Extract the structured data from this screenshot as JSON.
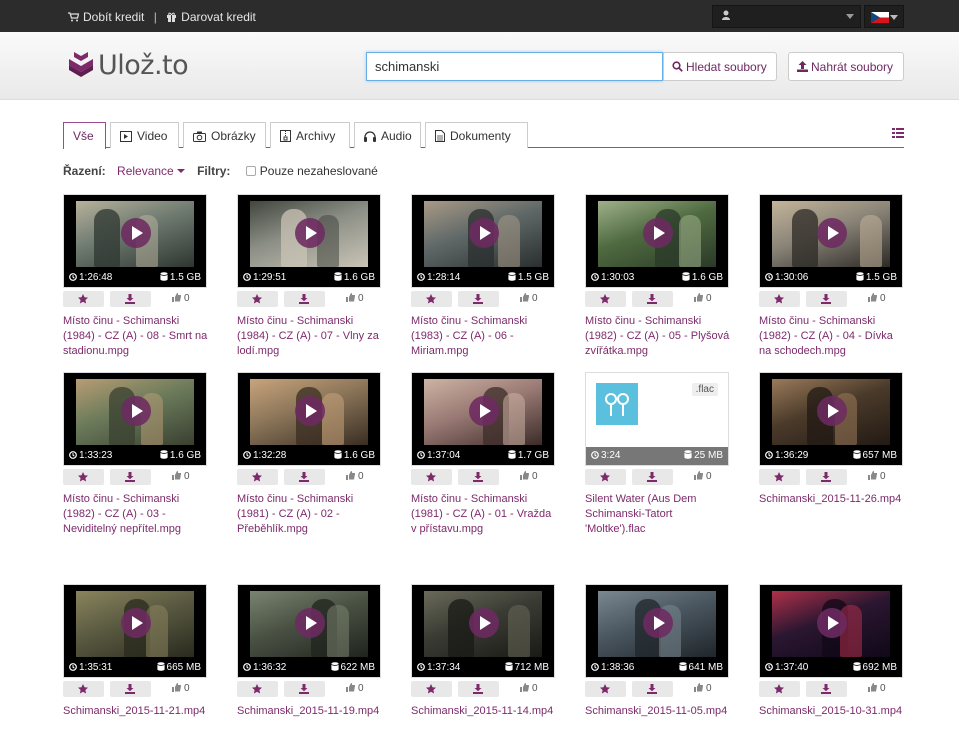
{
  "topbar": {
    "credit_link": "Dobít kredit",
    "gift_link": "Darovat kredit",
    "user_name": ""
  },
  "brand": {
    "name": "Ulož.to",
    "accent": "#7d2a6b"
  },
  "search": {
    "value": "schimanski",
    "button_label": "Hledat soubory"
  },
  "upload": {
    "button_label": "Nahrát soubory"
  },
  "tabs": [
    {
      "label": "Vše",
      "icon": "none",
      "active": true
    },
    {
      "label": "Video",
      "icon": "video-icon"
    },
    {
      "label": "Obrázky",
      "icon": "camera-icon"
    },
    {
      "label": "Archivy",
      "icon": "archive-icon"
    },
    {
      "label": "Audio",
      "icon": "headphones-icon"
    },
    {
      "label": "Dokumenty",
      "icon": "document-icon"
    }
  ],
  "filters": {
    "sort_label": "Řazení:",
    "sort_value": "Relevance",
    "filter_label": "Filtry:",
    "checkbox_label": "Pouze nezaheslované"
  },
  "files": [
    {
      "name": "Místo činu - Schimanski (1984) - CZ (A) - 08 - Smrt na stadionu.mpg",
      "duration": "1:26:48",
      "size": "1.5 GB",
      "likes": "0",
      "type": "video",
      "palette": [
        "#6e7a70",
        "#b7b29c",
        "#2e3530"
      ]
    },
    {
      "name": "Místo činu - Schimanski (1984) - CZ (A) - 07 - Vlny za lodí.mpg",
      "duration": "1:29:51",
      "size": "1.6 GB",
      "likes": "0",
      "type": "video",
      "palette": [
        "#8c8f86",
        "#42463e",
        "#c9c4b6"
      ]
    },
    {
      "name": "Místo činu - Schimanski (1983) - CZ (A) - 06 - Miriam.mpg",
      "duration": "1:28:14",
      "size": "1.5 GB",
      "likes": "0",
      "type": "video",
      "palette": [
        "#5f6868",
        "#a89a86",
        "#2a2e2e"
      ]
    },
    {
      "name": "Místo činu - Schimanski (1982) - CZ (A) - 05 - Plyšová zvířátka.mpg",
      "duration": "1:30:03",
      "size": "1.6 GB",
      "likes": "0",
      "type": "video",
      "palette": [
        "#4f6a40",
        "#9fb08a",
        "#2a3a28"
      ]
    },
    {
      "name": "Místo činu - Schimanski (1982) - CZ (A) - 04 - Dívka na schodech.mpg",
      "duration": "1:30:06",
      "size": "1.5 GB",
      "likes": "0",
      "type": "video",
      "palette": [
        "#8a8478",
        "#c4b59a",
        "#2c2a26"
      ]
    },
    {
      "name": "Místo činu - Schimanski (1982) - CZ (A) - 03 - Neviditelný nepřítel.mpg",
      "duration": "1:33:23",
      "size": "1.6 GB",
      "likes": "0",
      "type": "video",
      "palette": [
        "#6a7a5a",
        "#b79d74",
        "#3a4030"
      ]
    },
    {
      "name": "Místo činu - Schimanski (1981) - CZ (A) - 02 - Přeběhlík.mpg",
      "duration": "1:32:28",
      "size": "1.6 GB",
      "likes": "0",
      "type": "video",
      "palette": [
        "#8a7458",
        "#c8a47c",
        "#3a2e22"
      ]
    },
    {
      "name": "Místo činu - Schimanski (1981) - CZ (A) - 01 - Vražda v přístavu.mpg",
      "duration": "1:37:04",
      "size": "1.7 GB",
      "likes": "0",
      "type": "video",
      "palette": [
        "#9a7a74",
        "#cdb3a4",
        "#3c2c2a"
      ]
    },
    {
      "name": "Silent Water (Aus Dem Schimanski-Tatort 'Moltke').flac",
      "duration": "3:24",
      "size": "25 MB",
      "likes": "0",
      "type": "audio",
      "ext": ".flac",
      "palette": [
        "#5bc0de",
        "#ffffff",
        "#777777"
      ]
    },
    {
      "name": "Schimanski_2015-11-26.mp4",
      "duration": "1:36:29",
      "size": "657 MB",
      "likes": "0",
      "type": "video",
      "palette": [
        "#4a3a2a",
        "#9a7a5a",
        "#221a14"
      ]
    },
    {
      "name": "Schimanski_2015-11-21.mp4",
      "duration": "1:35:31",
      "size": "665 MB",
      "likes": "0",
      "type": "video",
      "palette": [
        "#5a5a42",
        "#8a845c",
        "#2a2a1e"
      ]
    },
    {
      "name": "Schimanski_2015-11-19.mp4",
      "duration": "1:36:32",
      "size": "622 MB",
      "likes": "0",
      "type": "video",
      "palette": [
        "#4a5244",
        "#7a8470",
        "#20241e"
      ]
    },
    {
      "name": "Schimanski_2015-11-14.mp4",
      "duration": "1:37:34",
      "size": "712 MB",
      "likes": "0",
      "type": "video",
      "palette": [
        "#3a3c34",
        "#6a6a5a",
        "#1a1a16"
      ]
    },
    {
      "name": "Schimanski_2015-11-05.mp4",
      "duration": "1:38:36",
      "size": "641 MB",
      "likes": "0",
      "type": "video",
      "palette": [
        "#4a5660",
        "#7a8890",
        "#20262a"
      ]
    },
    {
      "name": "Schimanski_2015-10-31.mp4",
      "duration": "1:37:40",
      "size": "692 MB",
      "likes": "0",
      "type": "video",
      "palette": [
        "#2a1630",
        "#b0304a",
        "#100818"
      ]
    }
  ]
}
